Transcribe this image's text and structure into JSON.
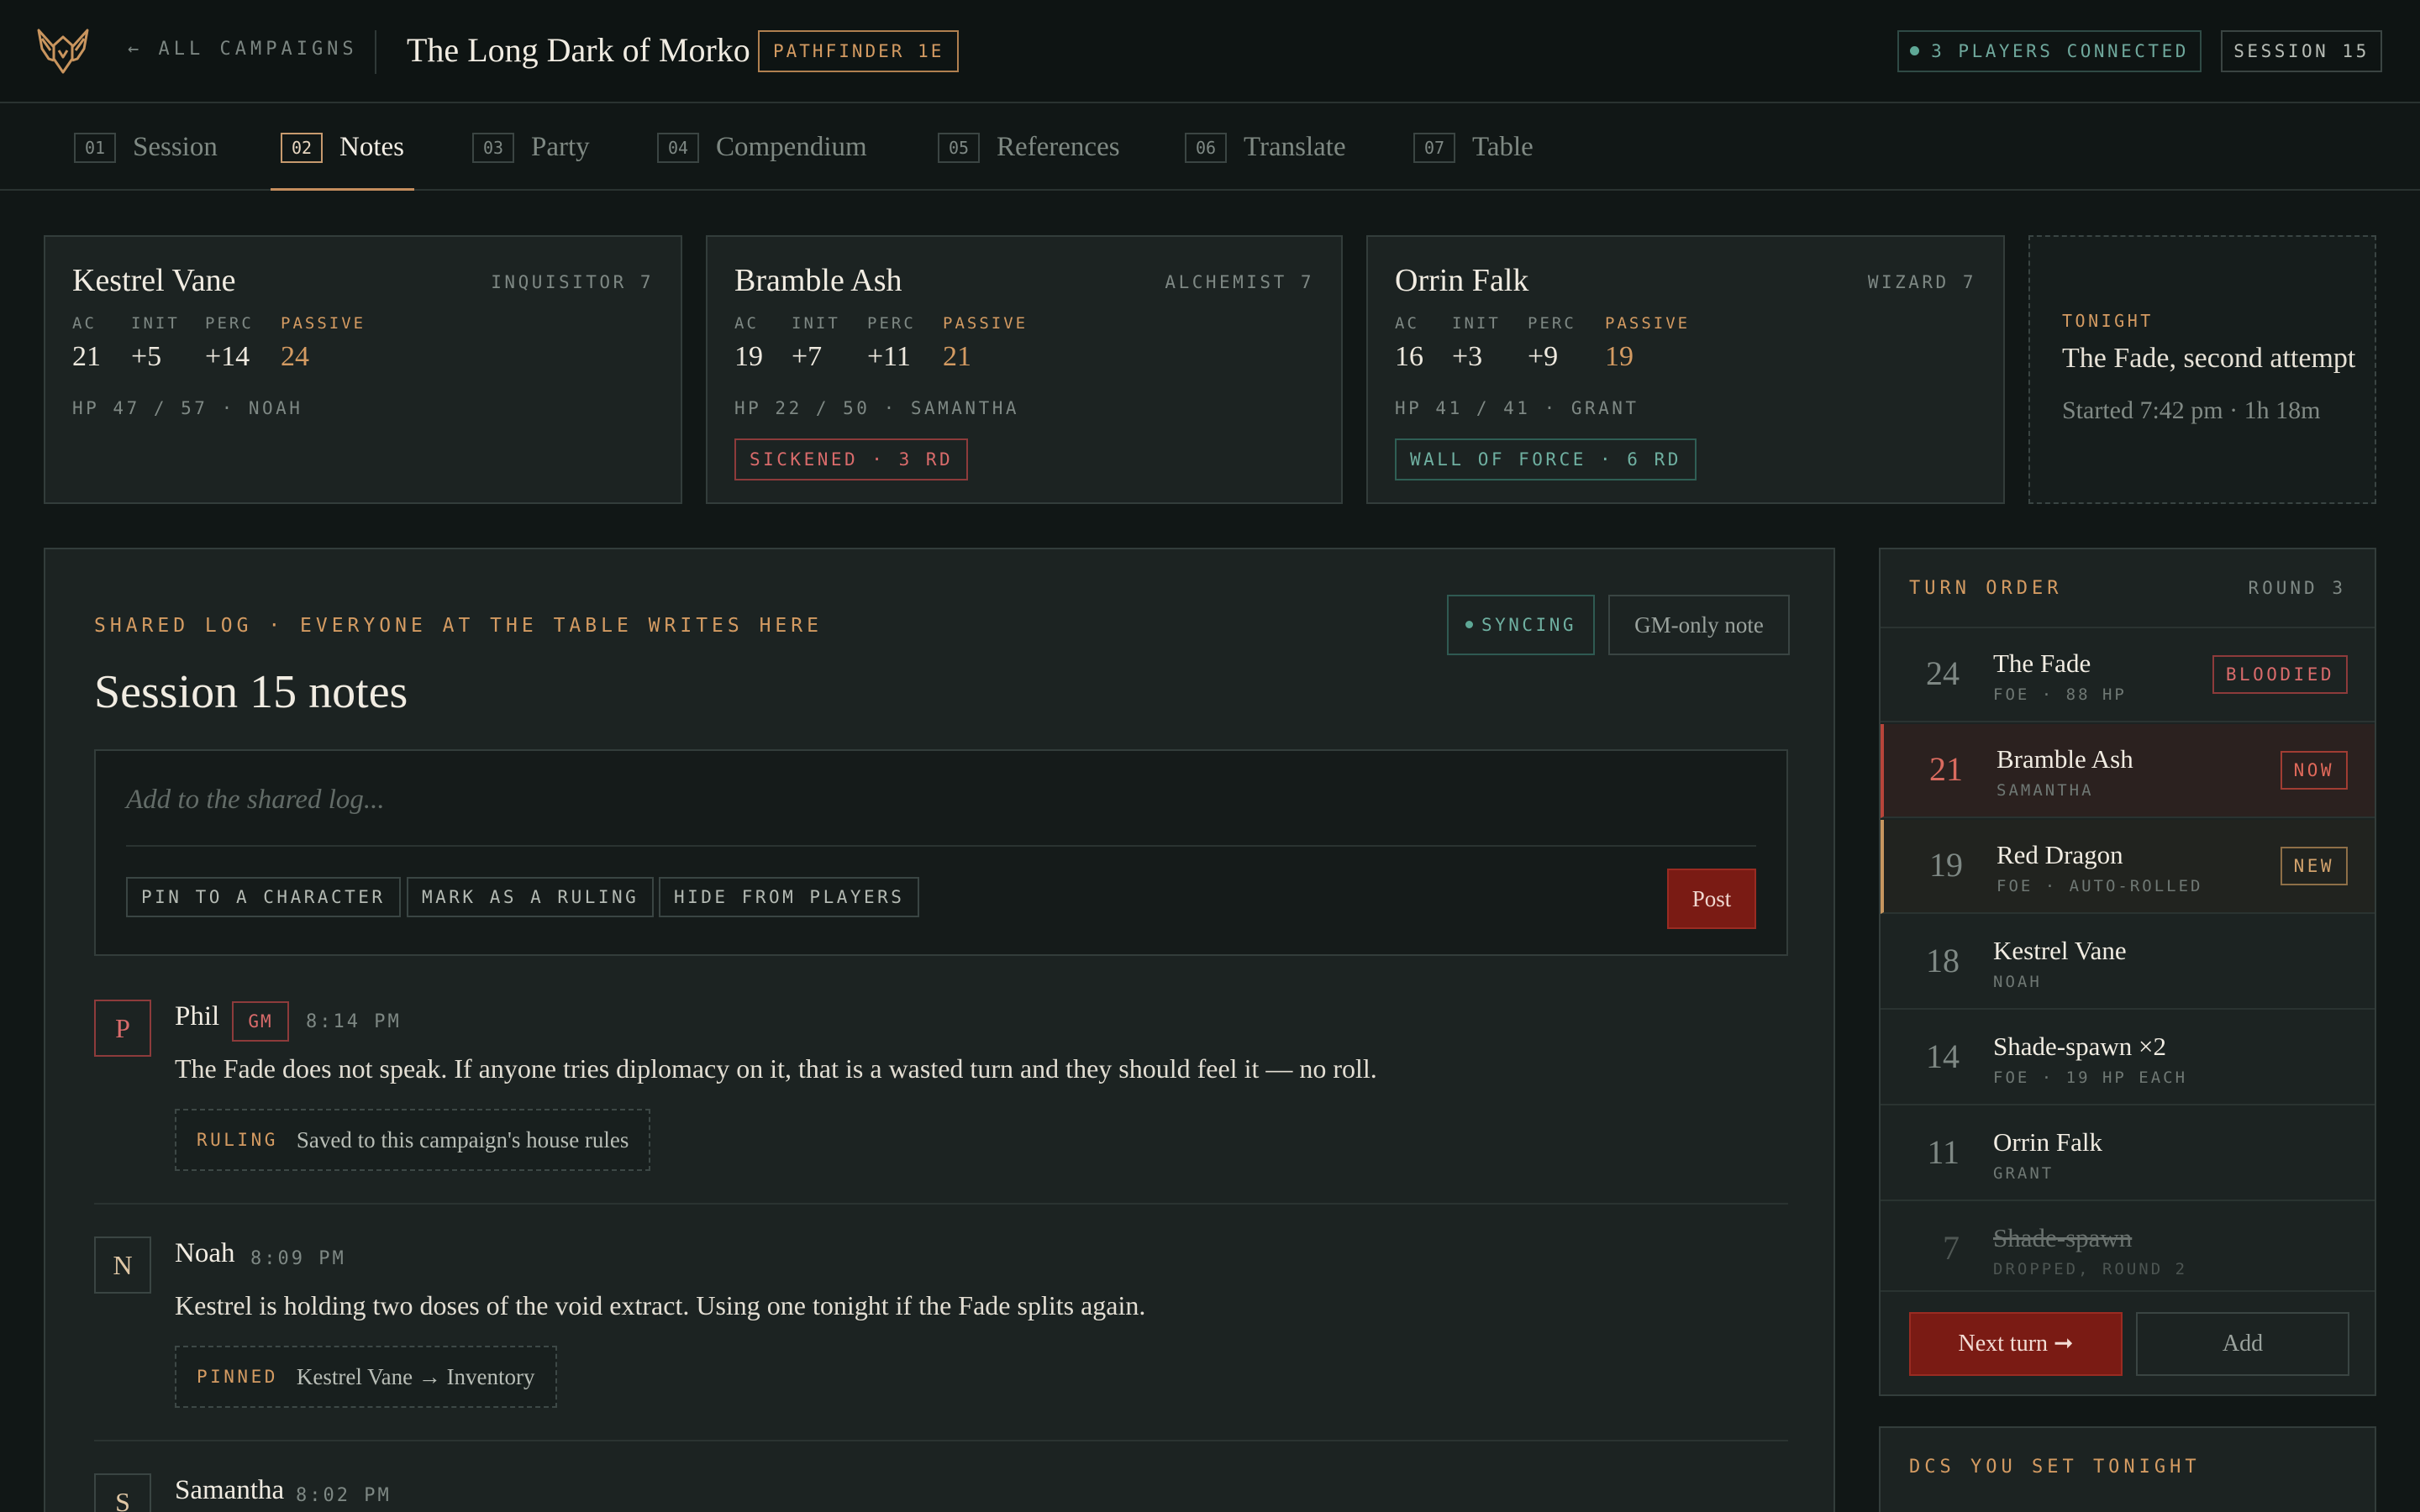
{
  "header": {
    "back_label": "← ALL CAMPAIGNS",
    "campaign_title": "The Long Dark of Morko",
    "system_badge": "PATHFINDER 1E",
    "players_connected": "3 PLAYERS CONNECTED",
    "session_badge": "SESSION 15",
    "logo_icon": "winged-helm-icon"
  },
  "tabs": [
    {
      "num": "01",
      "label": "Session"
    },
    {
      "num": "02",
      "label": "Notes",
      "active": true
    },
    {
      "num": "03",
      "label": "Party"
    },
    {
      "num": "04",
      "label": "Compendium"
    },
    {
      "num": "05",
      "label": "References"
    },
    {
      "num": "06",
      "label": "Translate"
    },
    {
      "num": "07",
      "label": "Table"
    }
  ],
  "characters": [
    {
      "name": "Kestrel Vane",
      "class": "INQUISITOR 7",
      "stats": {
        "ac_label": "AC",
        "ac": "21",
        "init_label": "INIT",
        "init": "+5",
        "perc_label": "PERC",
        "perc": "+14",
        "passive_label": "PASSIVE",
        "passive": "24"
      },
      "hp": "HP 47 / 57 · NOAH",
      "condition": ""
    },
    {
      "name": "Bramble Ash",
      "class": "ALCHEMIST 7",
      "stats": {
        "ac_label": "AC",
        "ac": "19",
        "init_label": "INIT",
        "init": "+7",
        "perc_label": "PERC",
        "perc": "+11",
        "passive_label": "PASSIVE",
        "passive": "21"
      },
      "hp": "HP 22 / 50 · SAMANTHA",
      "condition": "SICKENED · 3 RD"
    },
    {
      "name": "Orrin Falk",
      "class": "WIZARD 7",
      "stats": {
        "ac_label": "AC",
        "ac": "16",
        "init_label": "INIT",
        "init": "+3",
        "perc_label": "PERC",
        "perc": "+9",
        "passive_label": "PASSIVE",
        "passive": "19"
      },
      "hp": "HP 41 / 41 · GRANT",
      "condition": "WALL OF FORCE · 6 RD"
    }
  ],
  "tonight": {
    "label": "TONIGHT",
    "title": "The Fade, second attempt",
    "started": "Started 7:42 pm · 1h 18m"
  },
  "log": {
    "eyebrow": "SHARED LOG · EVERYONE AT THE TABLE WRITES HERE",
    "title": "Session 15 notes",
    "syncing": "SYNCING",
    "gm_only": "GM-only note",
    "composer_placeholder": "Add to the shared log...",
    "chips": [
      "PIN TO A CHARACTER",
      "MARK AS A RULING",
      "HIDE FROM PLAYERS"
    ],
    "post_label": "Post",
    "entries": [
      {
        "initial": "P",
        "author": "Phil",
        "gm_tag": "GM",
        "time": "8:14 PM",
        "text": "The Fade does not speak. If anyone tries diplomacy on it, that is a wasted turn and they should feel it — no roll.",
        "tag_key": "RULING",
        "tag_value": "Saved to this campaign's house rules"
      },
      {
        "initial": "N",
        "author": "Noah",
        "time": "8:09 PM",
        "text": "Kestrel is holding two doses of the void extract. Using one tonight if the Fade splits again.",
        "tag_key": "PINNED",
        "tag_value": "Kestrel Vane → Inventory"
      },
      {
        "initial": "S",
        "author": "Samantha",
        "time": "8:02 PM"
      }
    ]
  },
  "turn_order": {
    "title": "TURN ORDER",
    "round": "ROUND 3",
    "rows": [
      {
        "init": "24",
        "name": "The Fade",
        "sub": "FOE · 88 HP",
        "pill": "BLOODIED",
        "state": "normal"
      },
      {
        "init": "21",
        "name": "Bramble Ash",
        "sub": "SAMANTHA",
        "pill": "NOW",
        "state": "active"
      },
      {
        "init": "19",
        "name": "Red Dragon",
        "sub": "FOE · AUTO-ROLLED",
        "pill": "NEW",
        "state": "new"
      },
      {
        "init": "18",
        "name": "Kestrel Vane",
        "sub": "NOAH",
        "pill": "",
        "state": "normal"
      },
      {
        "init": "14",
        "name": "Shade-spawn ×2",
        "sub": "FOE · 19 HP EACH",
        "pill": "",
        "state": "normal"
      },
      {
        "init": "11",
        "name": "Orrin Falk",
        "sub": "GRANT",
        "pill": "",
        "state": "normal"
      },
      {
        "init": "7",
        "name": "Shade-spawn",
        "sub": "DROPPED, ROUND 2",
        "pill": "",
        "state": "dropped"
      }
    ],
    "next_label": "Next turn ➞",
    "add_label": "Add"
  },
  "dcs": {
    "title": "DCS YOU SET TONIGHT"
  },
  "colors": {
    "accent": "#d49b62",
    "danger": "#d96b6b",
    "ok": "#6fb0a1",
    "primary_button": "#7a1b14"
  }
}
